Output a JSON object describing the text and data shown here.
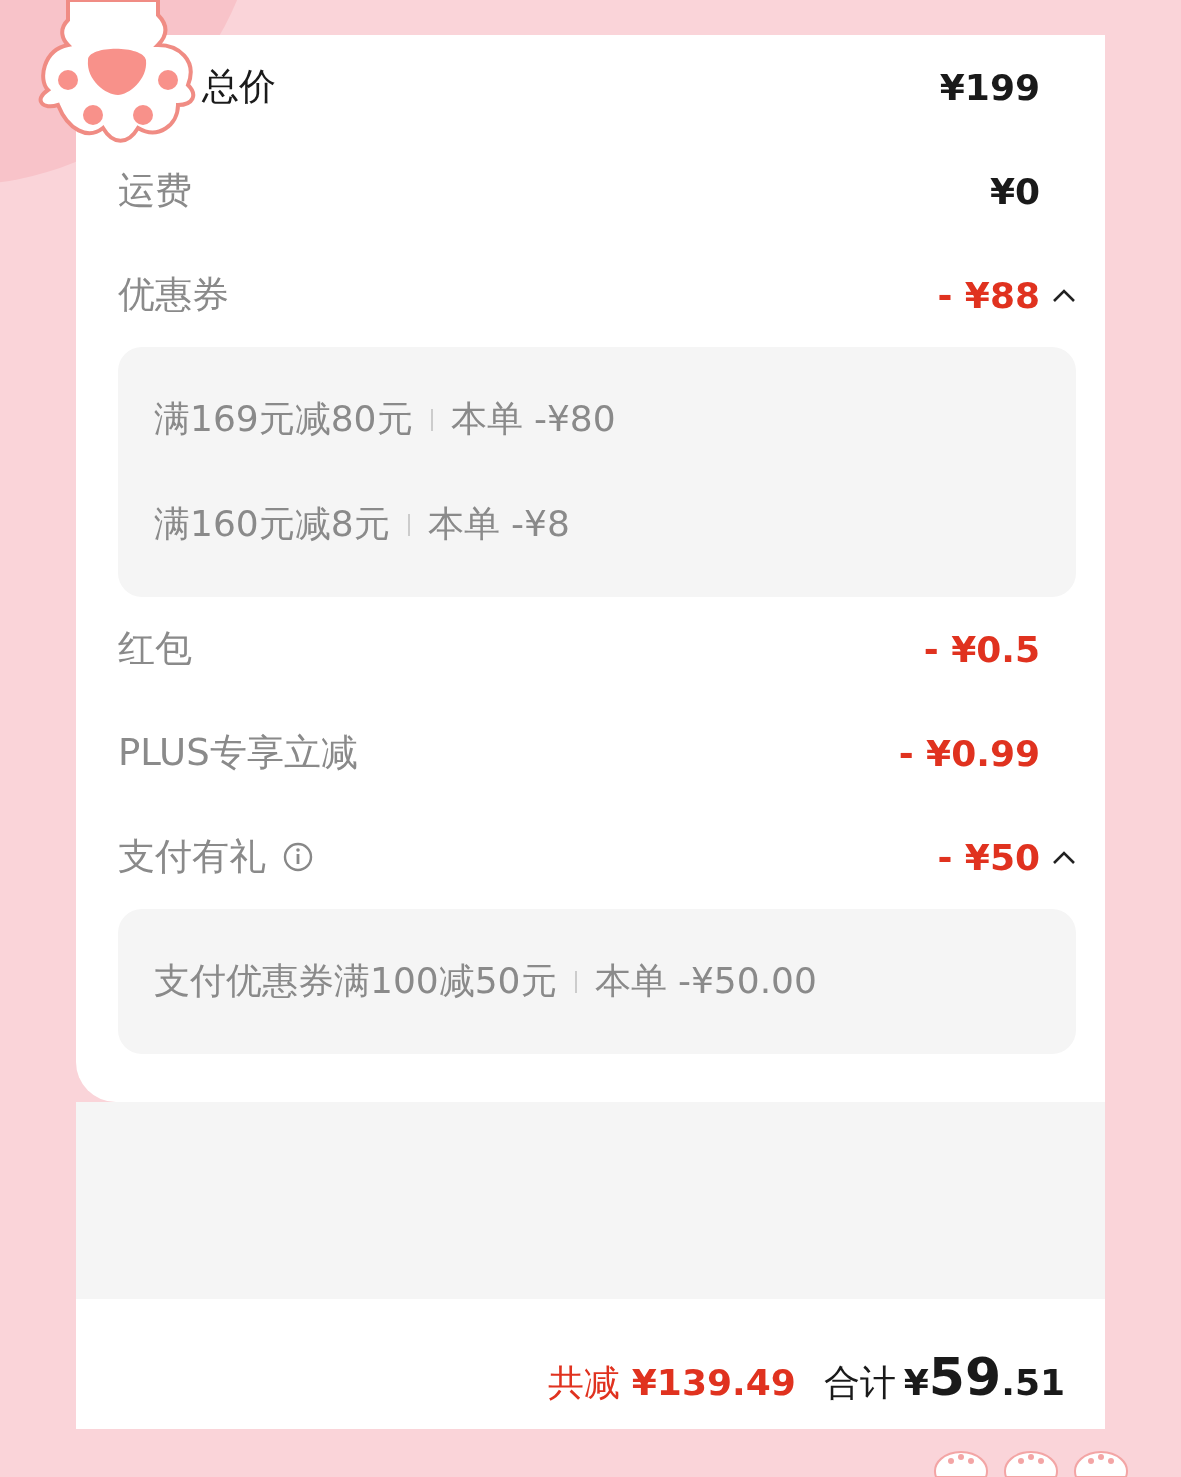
{
  "rows": [
    {
      "kind": "total",
      "label": "总价",
      "amount": "¥199"
    },
    {
      "kind": "plain",
      "label": "运费",
      "amount": "¥0"
    },
    {
      "kind": "discount",
      "label": "优惠券",
      "amount": "- ¥88",
      "expanded": true,
      "details": [
        {
          "condition": "满169元减80元",
          "amount": "本单 -¥80"
        },
        {
          "condition": "满160元减8元",
          "amount": "本单 -¥8"
        }
      ]
    },
    {
      "kind": "discount",
      "label": "红包",
      "amount": "- ¥0.5"
    },
    {
      "kind": "discount",
      "label": "PLUS专享立减",
      "amount": "- ¥0.99"
    },
    {
      "kind": "discount",
      "label": "支付有礼",
      "info": true,
      "amount": "- ¥50",
      "expanded": true,
      "details": [
        {
          "condition": "支付优惠券满100减50元",
          "amount": "本单 -¥50.00"
        }
      ]
    }
  ],
  "footer": {
    "saved_label": "共减",
    "saved_amount": "¥139.49",
    "total_label": "合计",
    "total_currency": "¥",
    "total_integer": "59",
    "total_decimal": ".51"
  }
}
